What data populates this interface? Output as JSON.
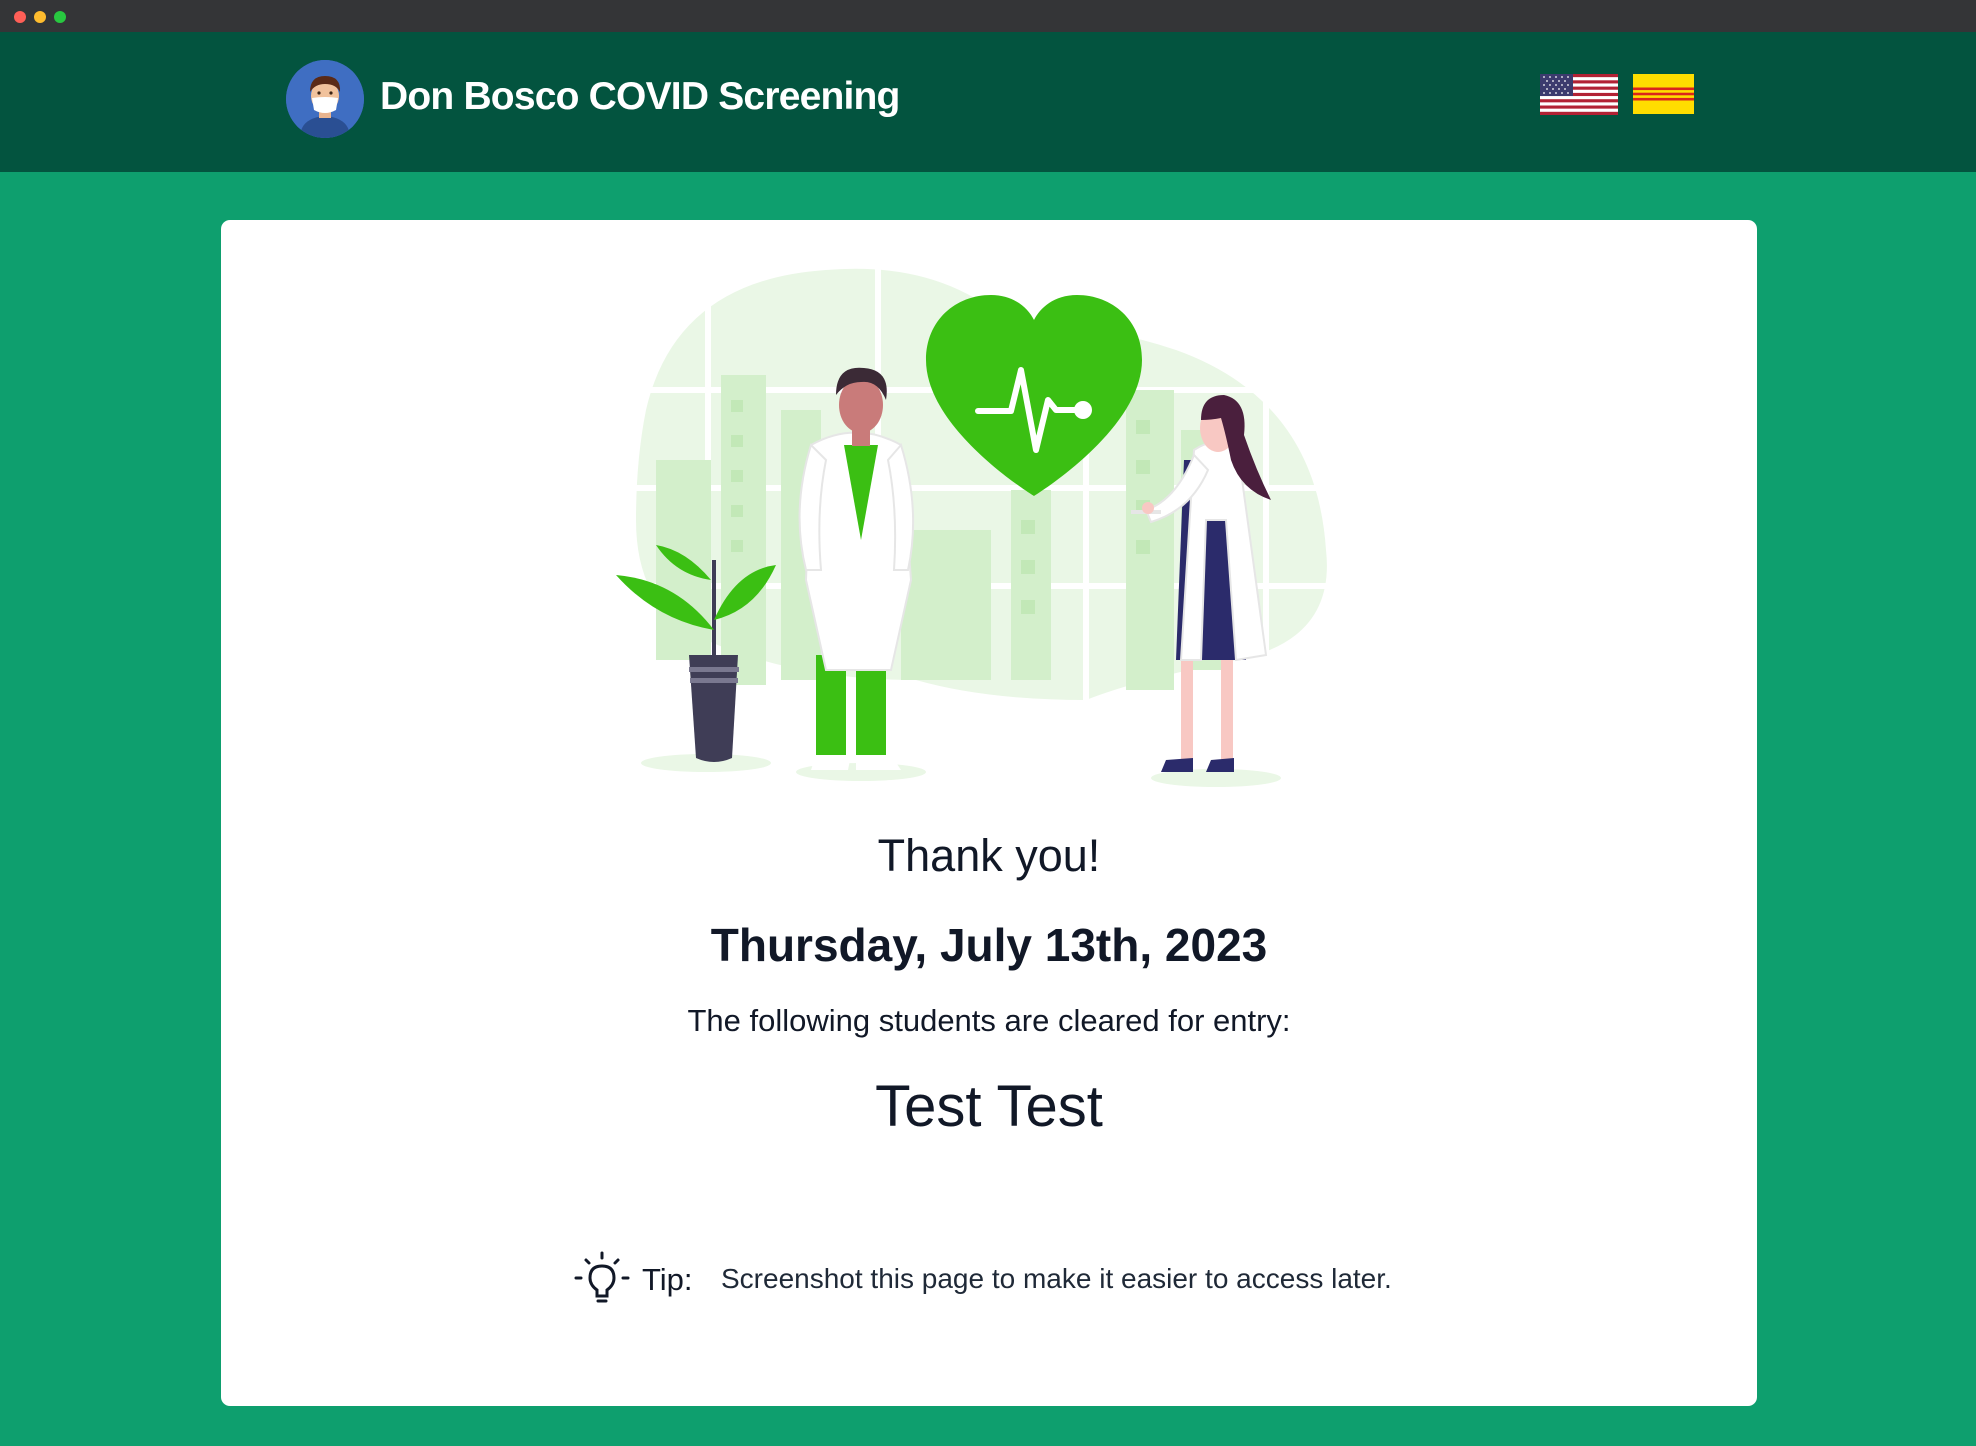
{
  "navbar": {
    "title": "Don Bosco COVID Screening"
  },
  "languages": [
    "english-flag",
    "vietnamese-flag"
  ],
  "confirmation": {
    "heading": "Thank you!",
    "date": "Thursday, July 13th, 2023",
    "cleared_text": "The following students are cleared for entry:",
    "students": [
      "Test Test"
    ]
  },
  "tip": {
    "label": "Tip:",
    "text": "Screenshot this page to make it easier to access later."
  },
  "colors": {
    "page_background": "#0e9f6e",
    "navbar_background": "#03543f",
    "illustration_accent": "#3bbf13"
  }
}
